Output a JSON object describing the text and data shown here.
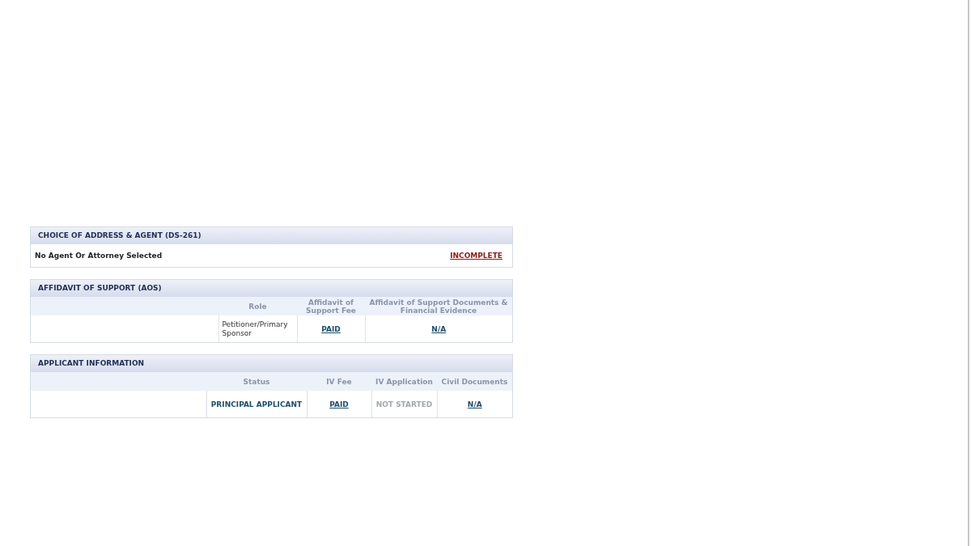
{
  "sections": [
    {
      "title": "CHOICE OF ADDRESS & AGENT (DS-261)",
      "kind": "summary",
      "label": "No Agent Or Attorney Selected",
      "status": {
        "text": "INCOMPLETE",
        "kind": "alert-link"
      }
    },
    {
      "title": "AFFIDAVIT OF SUPPORT (AOS)",
      "kind": "table",
      "columns": [
        "Role",
        "Affidavit of Support Fee",
        "Affidavit of Support Documents & Financial Evidence"
      ],
      "rows": [
        {
          "cells": [
            {
              "text": "Petitioner/Primary Sponsor",
              "kind": "text"
            },
            {
              "text": "PAID",
              "kind": "link"
            },
            {
              "text": "N/A",
              "kind": "link"
            }
          ]
        }
      ]
    },
    {
      "title": "APPLICANT INFORMATION",
      "kind": "table",
      "columns": [
        "Status",
        "IV Fee",
        "IV Application",
        "Civil Documents"
      ],
      "rows": [
        {
          "cells": [
            {
              "text": "PRINCIPAL APPLICANT",
              "kind": "status"
            },
            {
              "text": "PAID",
              "kind": "link"
            },
            {
              "text": "NOT STARTED",
              "kind": "muted"
            },
            {
              "text": "N/A",
              "kind": "link"
            }
          ]
        }
      ]
    }
  ]
}
